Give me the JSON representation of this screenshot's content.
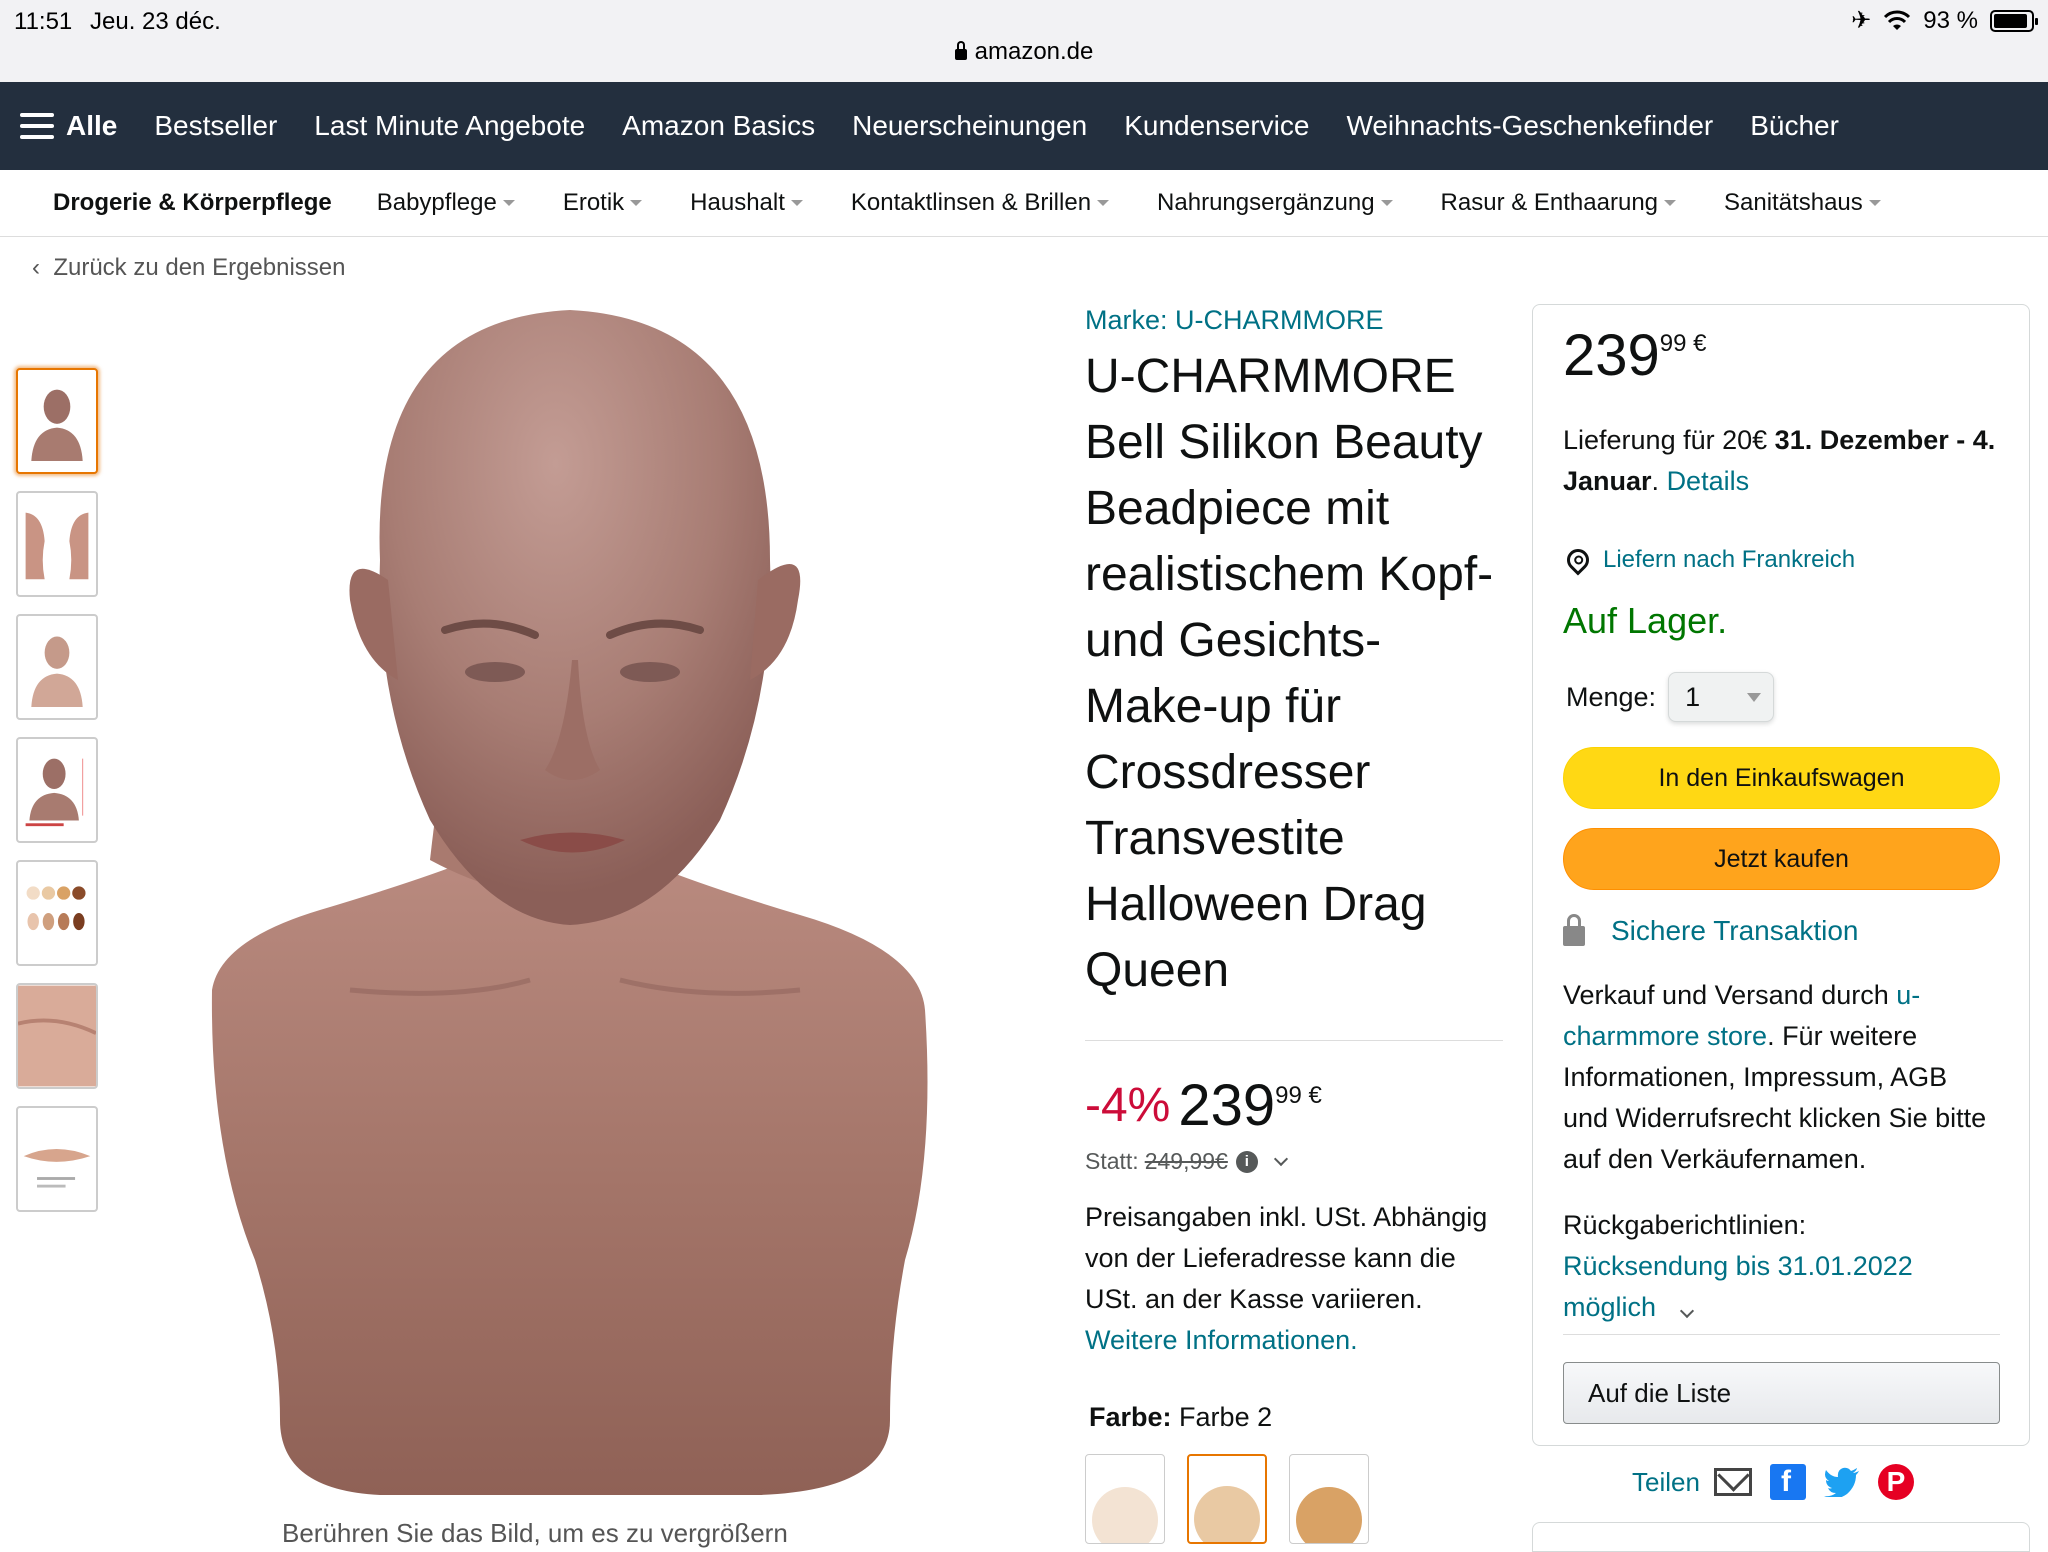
{
  "status_bar": {
    "time": "11:51",
    "date": "Jeu. 23 déc.",
    "battery": "93 %",
    "url": "amazon.de"
  },
  "nav": {
    "all_label": "Alle",
    "items": [
      "Bestseller",
      "Last Minute Angebote",
      "Amazon Basics",
      "Neuerscheinungen",
      "Kundenservice",
      "Weihnachts-Geschenkefinder",
      "Bücher"
    ]
  },
  "subnav": {
    "category": "Drogerie & Körperpflege",
    "items": [
      "Babypflege",
      "Erotik",
      "Haushalt",
      "Kontaktlinsen & Brillen",
      "Nahrungsergänzung",
      "Rasur & Enthaarung",
      "Sanitätshaus"
    ]
  },
  "back_link": "Zurück zu den Ergebnissen",
  "gallery": {
    "thumb_count": 7,
    "active_index": 0,
    "caption": "Berühren Sie das Bild, um es zu vergrößern"
  },
  "product": {
    "brand": "Marke: U-CHARMMORE",
    "title": "U-CHARMMORE Bell Silikon Beauty Beadpiece mit realistischem Kopf- und Gesichts-Make-up für Crossdresser Transvestite Halloween Drag Queen",
    "discount": "-4%",
    "price_whole": "239",
    "price_fraction": "99",
    "currency": "€",
    "old_price_label": "Statt:",
    "old_price": "249,99€",
    "tax_text": "Preisangaben inkl. USt. Abhängig von der Lieferadresse kann die USt. an der Kasse variieren.",
    "tax_link": "Weitere Informationen.",
    "color_label": "Farbe:",
    "color_value": "Farbe 2",
    "swatches": [
      "#f3e3d3",
      "#e9c9a3",
      "#d9a265"
    ]
  },
  "buybox": {
    "price_whole": "239",
    "price_fraction": "99",
    "currency": "€",
    "delivery_prefix": "Lieferung für 20€",
    "delivery_dates": "31. Dezember - 4. Januar",
    "delivery_link": "Details",
    "location": "Liefern nach Frankreich",
    "stock": "Auf Lager.",
    "qty_label": "Menge:",
    "qty_value": "1",
    "add_to_cart": "In den Einkaufswagen",
    "buy_now": "Jetzt kaufen",
    "secure": "Sichere Transaktion",
    "seller_prefix": "Verkauf und Versand durch",
    "seller_link": "u-charmmore store",
    "seller_suffix": ". Für weitere Informationen, Impressum, AGB und Widerrufsrecht klicken Sie bitte auf den Verkäufernamen.",
    "return_label": "Rückgaberichtlinien:",
    "return_link": "Rücksendung bis 31.01.2022 möglich",
    "wishlist": "Auf die Liste",
    "share_label": "Teilen"
  },
  "colors": {
    "nav_bg": "#232f3e",
    "link": "#007185",
    "discount": "#cc0c39",
    "stock": "#007600",
    "cart_btn": "#ffd814",
    "buy_btn": "#ffa41c"
  }
}
